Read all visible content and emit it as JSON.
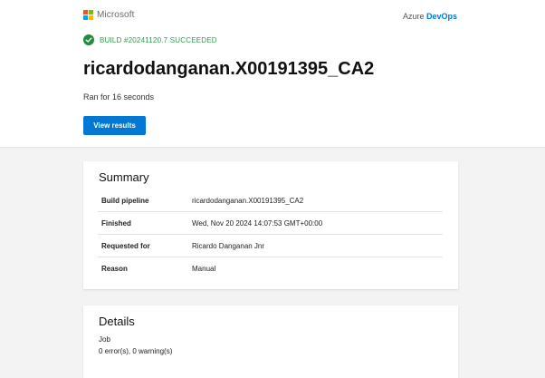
{
  "brand": {
    "name": "Microsoft",
    "logo_colors": [
      "#f25022",
      "#7fba00",
      "#00a4ef",
      "#ffb900"
    ]
  },
  "product": {
    "prefix": "Azure",
    "name": "DevOps"
  },
  "build": {
    "status": "BUILD #20241120.7 SUCCEEDED",
    "status_color": "#2c9b4a",
    "title": "ricardodanganan.X00191395_CA2",
    "duration": "Ran for 16 seconds",
    "action_label": "View results"
  },
  "summary": {
    "title": "Summary",
    "rows": [
      {
        "label": "Build pipeline",
        "value": "ricardodanganan.X00191395_CA2"
      },
      {
        "label": "Finished",
        "value": "Wed, Nov 20 2024 14:07:53 GMT+00:00"
      },
      {
        "label": "Requested for",
        "value": "Ricardo Danganan Jnr"
      },
      {
        "label": "Reason",
        "value": "Manual"
      }
    ]
  },
  "details": {
    "title": "Details",
    "job_label": "Job",
    "job_result": "0 error(s), 0 warning(s)"
  },
  "colors": {
    "accent": "#0078d4",
    "success": "#1e8e3e",
    "background": "#f3f3f3"
  }
}
